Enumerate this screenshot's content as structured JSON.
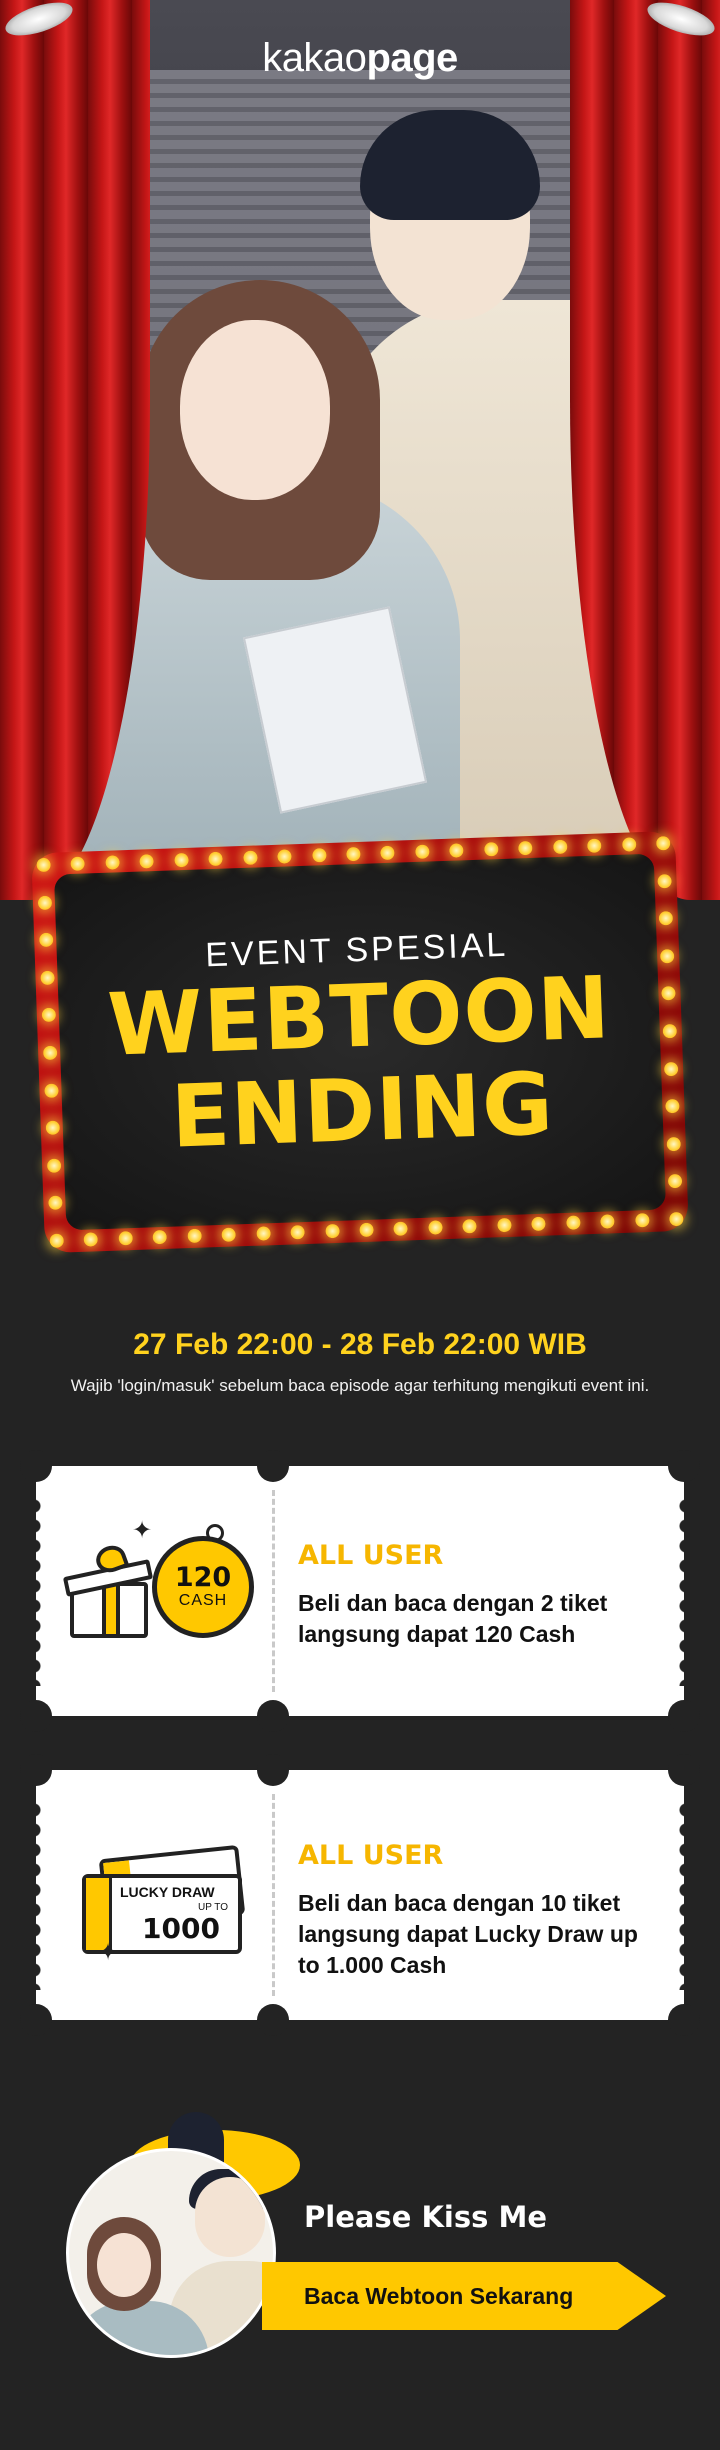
{
  "brand": {
    "logo_light": "kakao",
    "logo_bold": "page"
  },
  "event": {
    "subtitle": "EVENT SPESIAL",
    "title_line1": "WEBTOON",
    "title_line2": "ENDING",
    "date_range": "27 Feb 22:00 - 28 Feb 22:00 WIB",
    "note": "Wajib 'login/masuk' sebelum baca episode agar terhitung mengikuti event ini."
  },
  "rewards": [
    {
      "audience": "ALL USER",
      "description": "Beli dan baca dengan 2 tiket langsung dapat 120 Cash",
      "icon": "gift-cash-icon",
      "badge_amount": "120",
      "badge_unit": "CASH"
    },
    {
      "audience": "ALL USER",
      "description": "Beli dan baca dengan 10 tiket langsung dapat Lucky Draw up to 1.000 Cash",
      "icon": "lucky-draw-ticket-icon",
      "ticket_title": "LUCKY DRAW",
      "ticket_prefix": "UP TO",
      "ticket_amount": "1000"
    }
  ],
  "cta": {
    "title": "Please Kiss Me",
    "button_label": "Baca Webtoon Sekarang"
  },
  "colors": {
    "background": "#232323",
    "accent_yellow": "#ffd21e",
    "curtain_red": "#c41616",
    "ticket_white": "#ffffff"
  }
}
